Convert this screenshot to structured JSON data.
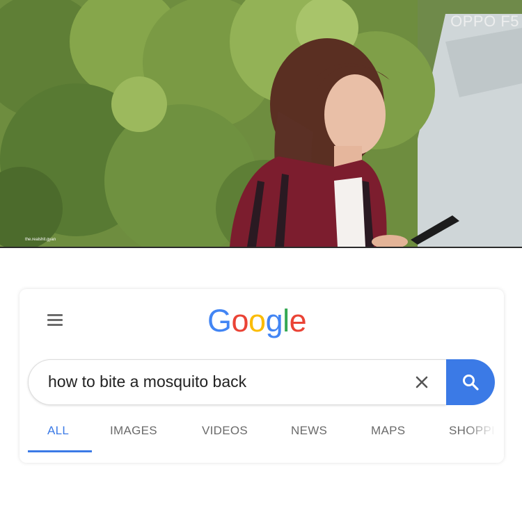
{
  "photo": {
    "watermark": "OPPO F5",
    "credit": "the.realshit.gyan"
  },
  "search": {
    "logo_letters": [
      {
        "char": "G",
        "color": "#4285F4"
      },
      {
        "char": "o",
        "color": "#EA4335"
      },
      {
        "char": "o",
        "color": "#FBBC05"
      },
      {
        "char": "g",
        "color": "#4285F4"
      },
      {
        "char": "l",
        "color": "#34A853"
      },
      {
        "char": "e",
        "color": "#EA4335"
      }
    ],
    "query": "how to bite a mosquito back",
    "accent_color": "#3b7ae6",
    "icons": {
      "menu": "menu-icon",
      "clear": "close-icon",
      "search": "search-icon"
    }
  },
  "tabs": [
    {
      "label": "ALL",
      "active": true
    },
    {
      "label": "IMAGES",
      "active": false
    },
    {
      "label": "VIDEOS",
      "active": false
    },
    {
      "label": "NEWS",
      "active": false
    },
    {
      "label": "MAPS",
      "active": false
    },
    {
      "label": "SHOPPI",
      "active": false
    }
  ]
}
